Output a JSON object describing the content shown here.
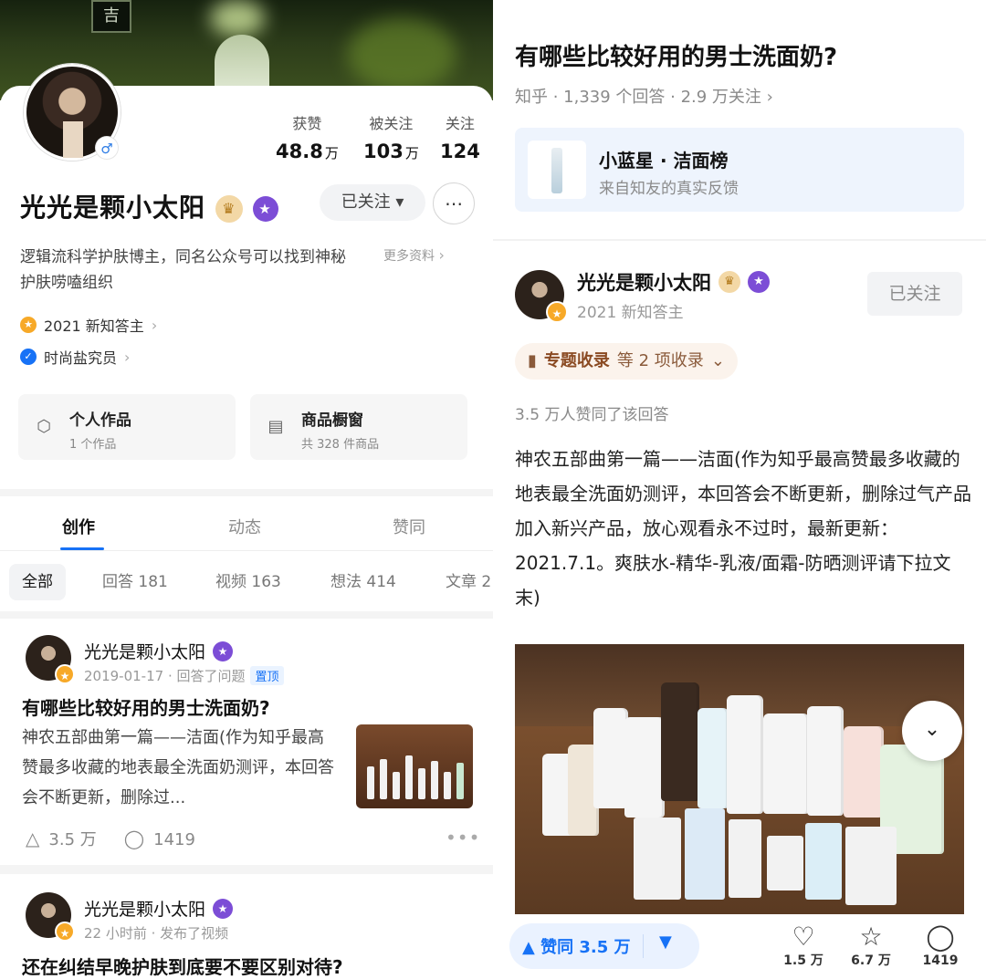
{
  "left": {
    "cover_sign": "吉",
    "stats": [
      {
        "label": "获赞",
        "value": "48.8",
        "unit": "万"
      },
      {
        "label": "被关注",
        "value": "103",
        "unit": "万"
      },
      {
        "label": "关注",
        "value": "124",
        "unit": ""
      }
    ],
    "gender": "♂",
    "name": "光光是颗小太阳",
    "follow_label": "已关注 ▾",
    "message_icon": "chat-icon",
    "bio": "逻辑流科学护肤博主，同名公众号可以找到神秘护肤唠嗑组织",
    "more_info": "更多资料",
    "tags": [
      {
        "text": "2021 新知答主",
        "color": "#f7a928"
      },
      {
        "text": "时尚盐究员",
        "color": "#1772f6"
      }
    ],
    "tiles": [
      {
        "title": "个人作品",
        "sub": "1 个作品"
      },
      {
        "title": "商品橱窗",
        "sub": "共 328 件商品"
      }
    ],
    "tabs": [
      "创作",
      "动态",
      "赞同"
    ],
    "filters": [
      "全部",
      "回答 181",
      "视频 163",
      "想法 414",
      "文章 2"
    ],
    "feed": [
      {
        "name": "光光是颗小太阳",
        "meta": "2019-01-17 · 回答了问题",
        "pin": "置顶",
        "title": "有哪些比较好用的男士洗面奶?",
        "excerpt": "神农五部曲第一篇——洁面(作为知乎最高赞最多收藏的地表最全洗面奶测评，本回答会不断更新，删除过...",
        "likes": "3.5 万",
        "comments": "1419"
      },
      {
        "name": "光光是颗小太阳",
        "meta": "22 小时前 · 发布了视频",
        "title": "还在纠结早晚护肤到底要不要区别对待?"
      }
    ]
  },
  "right": {
    "question_title": "有哪些比较好用的男士洗面奶?",
    "question_meta": "知乎 · 1,339 个回答 · 2.9 万关注 ›",
    "card_title": "小蓝星 · 洁面榜",
    "card_sub": "来自知友的真实反馈",
    "author_name": "光光是颗小太阳",
    "author_sub": "2021 新知答主",
    "follow_label": "已关注",
    "collection_label": "专题收录",
    "collection_suffix": "等 2 项收录",
    "likes_line": "3.5 万人赞同了该回答",
    "body": "神农五部曲第一篇——洁面(作为知乎最高赞最多收藏的地表最全洗面奶测评，本回答会不断更新，删除过气产品加入新兴产品，放心观看永不过时，最新更新：2021.7.1。爽肤水-精华-乳液/面霜-防晒测评请下拉文末)",
    "vote_label": "▲ 赞同 3.5 万",
    "bottom": [
      {
        "icon": "heart-icon",
        "glyph": "♡",
        "count": "1.5 万"
      },
      {
        "icon": "star-icon",
        "glyph": "☆",
        "count": "6.7 万"
      },
      {
        "icon": "comment-icon",
        "glyph": "◯",
        "count": "1419"
      }
    ]
  }
}
